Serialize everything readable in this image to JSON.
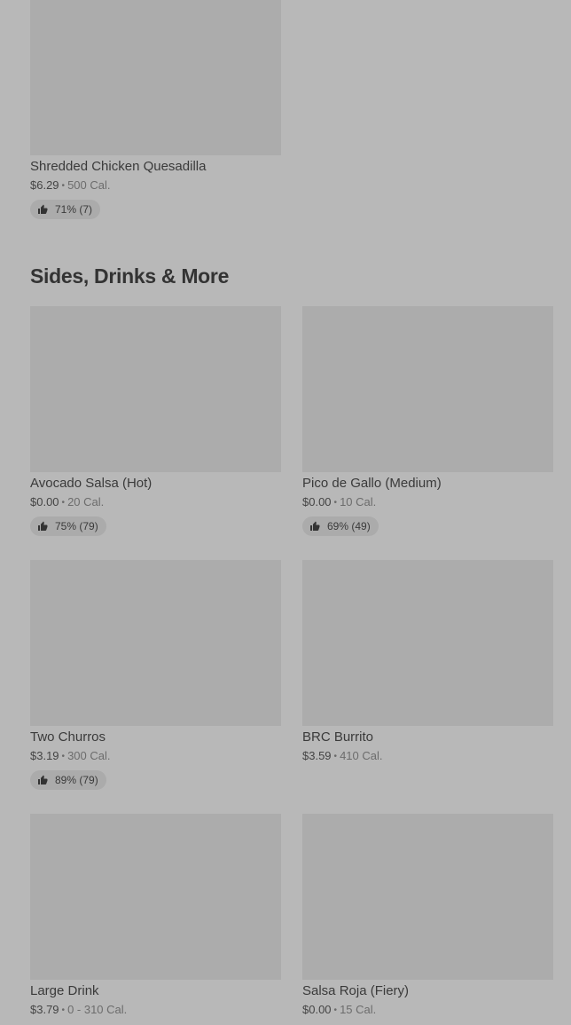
{
  "top_item": {
    "name": "Shredded Chicken Quesadilla",
    "price": "$6.29",
    "calories": "500 Cal.",
    "rating": "71% (7)"
  },
  "section": {
    "title": "Sides, Drinks & More",
    "items": [
      {
        "name": "Avocado Salsa (Hot)",
        "price": "$0.00",
        "calories": "20 Cal.",
        "rating": "75% (79)"
      },
      {
        "name": "Pico de Gallo (Medium)",
        "price": "$0.00",
        "calories": "10 Cal.",
        "rating": "69% (49)"
      },
      {
        "name": "Two Churros",
        "price": "$3.19",
        "calories": "300 Cal.",
        "rating": "89% (79)"
      },
      {
        "name": "BRC Burrito",
        "price": "$3.59",
        "calories": "410 Cal.",
        "rating": ""
      },
      {
        "name": "Large Drink",
        "price": "$3.79",
        "calories": "0 - 310 Cal.",
        "rating": ""
      },
      {
        "name": "Salsa Roja (Fiery)",
        "price": "$0.00",
        "calories": "15 Cal.",
        "rating": ""
      }
    ]
  },
  "separator": "•",
  "icons": {
    "rating": "thumbs-up-icon"
  }
}
